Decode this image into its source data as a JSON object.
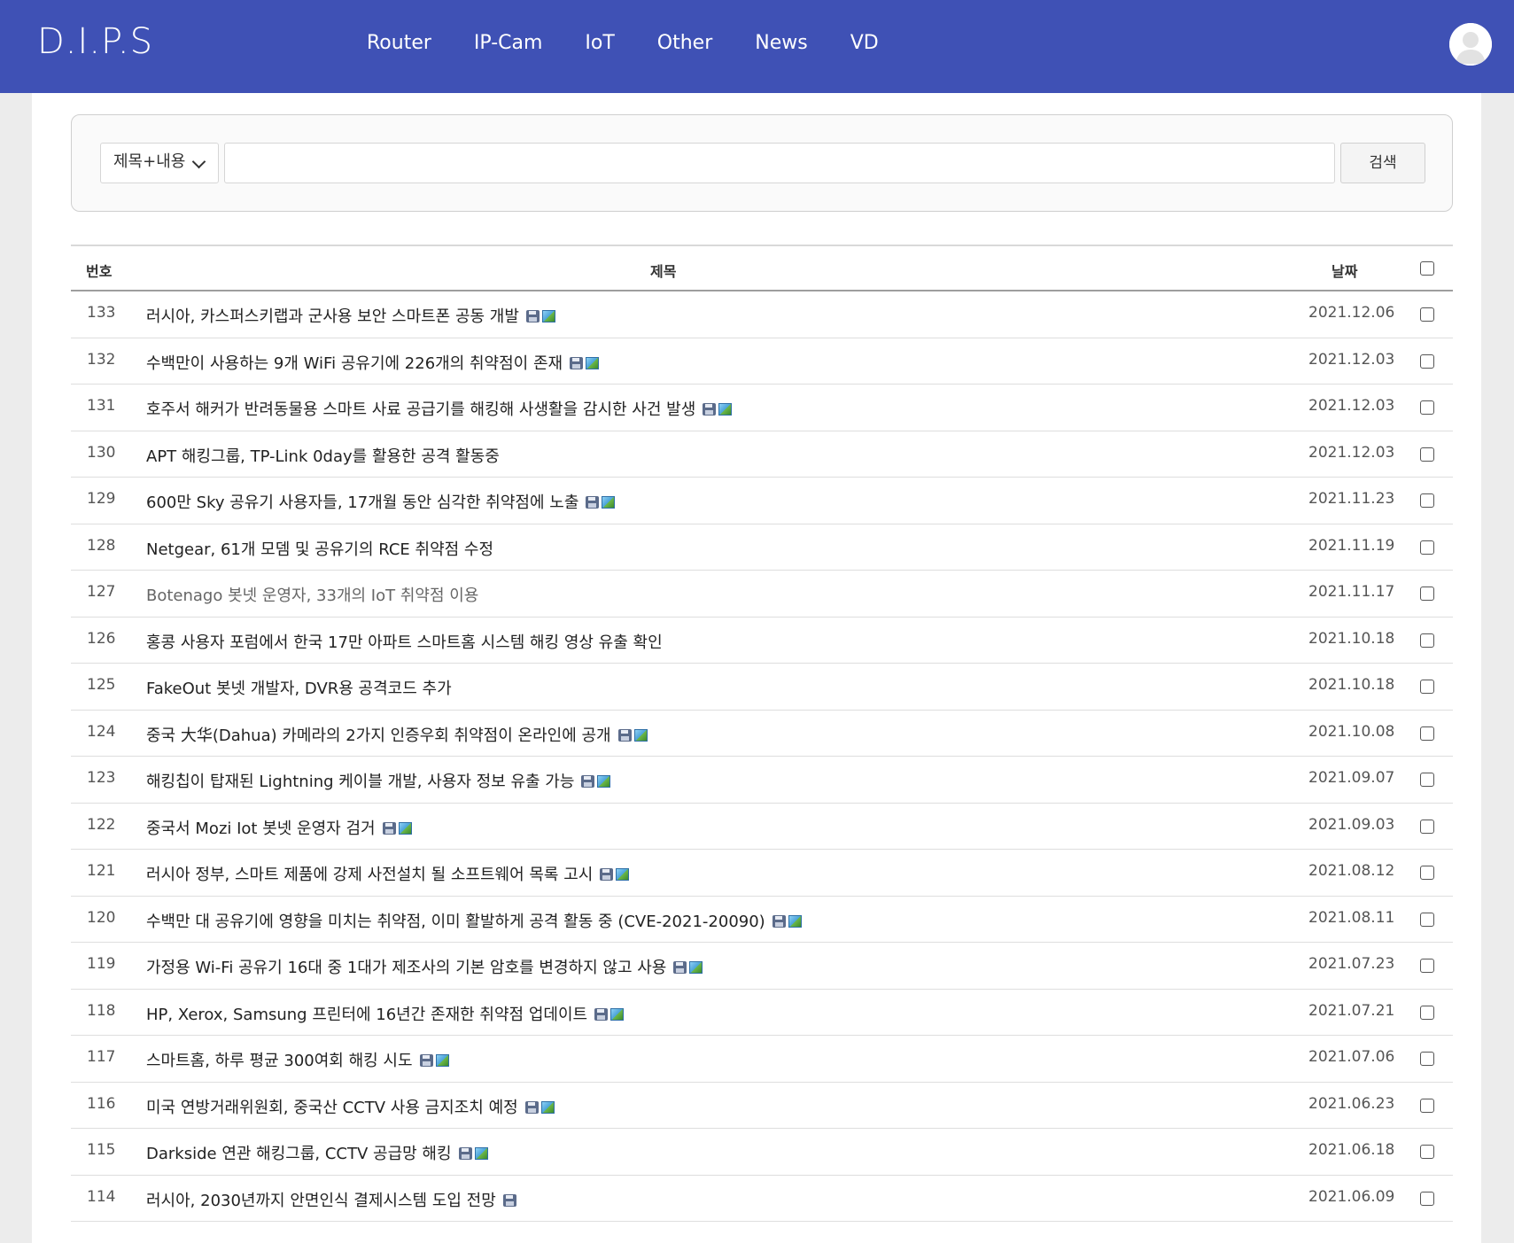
{
  "header": {
    "logo": "D.I.P.S",
    "nav": [
      "Router",
      "IP-Cam",
      "IoT",
      "Other",
      "News",
      "VD"
    ]
  },
  "search": {
    "select_value": "제목+내용",
    "input_value": "",
    "button_label": "검색"
  },
  "table": {
    "columns": {
      "num": "번호",
      "title": "제목",
      "date": "날짜"
    },
    "rows": [
      {
        "num": "133",
        "title": "러시아, 카스퍼스키랩과 군사용 보안 스마트폰 공동 개발",
        "date": "2021.12.06",
        "icons": [
          "disk-icon",
          "image-icon"
        ]
      },
      {
        "num": "132",
        "title": "수백만이 사용하는 9개 WiFi 공유기에 226개의 취약점이 존재",
        "date": "2021.12.03",
        "icons": [
          "disk-icon",
          "image-icon"
        ]
      },
      {
        "num": "131",
        "title": "호주서 해커가 반려동물용 스마트 사료 공급기를 해킹해 사생활을 감시한 사건 발생",
        "date": "2021.12.03",
        "icons": [
          "disk-icon",
          "image-icon"
        ]
      },
      {
        "num": "130",
        "title": "APT 해킹그룹, TP-Link 0day를 활용한 공격 활동중",
        "date": "2021.12.03",
        "icons": []
      },
      {
        "num": "129",
        "title": "600만 Sky 공유기 사용자들, 17개월 동안 심각한 취약점에 노출",
        "date": "2021.11.23",
        "icons": [
          "disk-icon",
          "image-icon"
        ]
      },
      {
        "num": "128",
        "title": "Netgear, 61개 모뎀 및 공유기의 RCE 취약점 수정",
        "date": "2021.11.19",
        "icons": []
      },
      {
        "num": "127",
        "title": "Botenago 봇넷 운영자, 33개의 IoT 취약점 이용",
        "date": "2021.11.17",
        "icons": [],
        "visited": true
      },
      {
        "num": "126",
        "title": "홍콩 사용자 포럼에서 한국 17만 아파트 스마트홈 시스템 해킹 영상 유출 확인",
        "date": "2021.10.18",
        "icons": []
      },
      {
        "num": "125",
        "title": "FakeOut 봇넷 개발자, DVR용 공격코드 추가",
        "date": "2021.10.18",
        "icons": []
      },
      {
        "num": "124",
        "title": "중국 大华(Dahua) 카메라의 2가지 인증우회 취약점이 온라인에 공개",
        "date": "2021.10.08",
        "icons": [
          "disk-icon",
          "image-icon"
        ]
      },
      {
        "num": "123",
        "title": "해킹칩이 탑재된 Lightning 케이블 개발, 사용자 정보 유출 가능",
        "date": "2021.09.07",
        "icons": [
          "disk-icon",
          "image-icon"
        ]
      },
      {
        "num": "122",
        "title": "중국서 Mozi Iot 봇넷 운영자 검거",
        "date": "2021.09.03",
        "icons": [
          "disk-icon",
          "image-icon"
        ]
      },
      {
        "num": "121",
        "title": "러시아 정부, 스마트 제품에 강제 사전설치 될 소프트웨어 목록 고시",
        "date": "2021.08.12",
        "icons": [
          "disk-icon",
          "image-icon"
        ]
      },
      {
        "num": "120",
        "title": "수백만 대 공유기에 영향을 미치는 취약점, 이미 활발하게 공격 활동 중 (CVE-2021-20090)",
        "date": "2021.08.11",
        "icons": [
          "disk-icon",
          "image-icon"
        ]
      },
      {
        "num": "119",
        "title": "가정용 Wi-Fi 공유기 16대 중 1대가 제조사의 기본 암호를 변경하지 않고 사용",
        "date": "2021.07.23",
        "icons": [
          "disk-icon",
          "image-icon"
        ]
      },
      {
        "num": "118",
        "title": "HP, Xerox, Samsung 프린터에 16년간 존재한 취약점 업데이트",
        "date": "2021.07.21",
        "icons": [
          "disk-icon",
          "image-icon"
        ]
      },
      {
        "num": "117",
        "title": "스마트홈, 하루 평균 300여회 해킹 시도",
        "date": "2021.07.06",
        "icons": [
          "disk-icon",
          "image-icon"
        ]
      },
      {
        "num": "116",
        "title": "미국 연방거래위원회, 중국산 CCTV 사용 금지조치 예정",
        "date": "2021.06.23",
        "icons": [
          "disk-icon",
          "image-icon"
        ]
      },
      {
        "num": "115",
        "title": "Darkside 연관 해킹그룹, CCTV 공급망 해킹",
        "date": "2021.06.18",
        "icons": [
          "disk-icon",
          "image-icon"
        ]
      },
      {
        "num": "114",
        "title": "러시아, 2030년까지 안면인식 결제시스템 도입 전망",
        "date": "2021.06.09",
        "icons": [
          "disk-icon"
        ]
      }
    ]
  }
}
